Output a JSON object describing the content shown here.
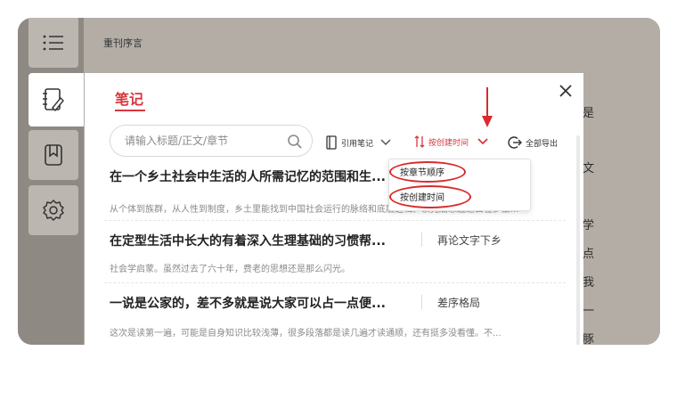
{
  "reader": {
    "chapter_title": "重刊序言",
    "side_chars": [
      "是",
      "文",
      "学",
      "点",
      "我",
      "一",
      "豚"
    ]
  },
  "sidebar": {
    "items": [
      {
        "name": "menu-icon",
        "active": false
      },
      {
        "name": "notebook-icon",
        "active": true
      },
      {
        "name": "bookmark-icon",
        "active": false
      },
      {
        "name": "gear-icon",
        "active": false
      }
    ]
  },
  "notes_panel": {
    "title": "笔记",
    "search": {
      "placeholder": "请输入标题/正文/章节",
      "value": ""
    },
    "toolbar": {
      "quote_notes_label": "引用笔记",
      "sort_label": "按创建时间",
      "export_label": "全部导出"
    },
    "sort_menu": {
      "options": [
        "按章节顺序",
        "按创建时间"
      ],
      "selected": "按创建时间"
    },
    "notes": [
      {
        "title": "在一个乡土社会中生活的人所需记忆的范围和生...",
        "chapter": "",
        "excerpt": "从个体到族群，从人性到制度，乡土里能找到中国社会运行的脉络和底层逻辑。读完后想起过去在乡土..."
      },
      {
        "title": "在定型生活中长大的有着深入生理基础的习惯帮...",
        "chapter": "再论文字下乡",
        "excerpt": "社会学启蒙。虽然过去了六十年，费老的思想还是那么闪光。"
      },
      {
        "title": "一说是公家的，差不多就是说大家可以占一点便...",
        "chapter": "差序格局",
        "excerpt": "这次是读第一遍，可能是自身知识比较浅薄，很多段落都是读几遍才读通顺，还有挺多没看懂。不..."
      }
    ]
  },
  "colors": {
    "accent": "#d9363e",
    "annotation": "#d92b2b"
  }
}
